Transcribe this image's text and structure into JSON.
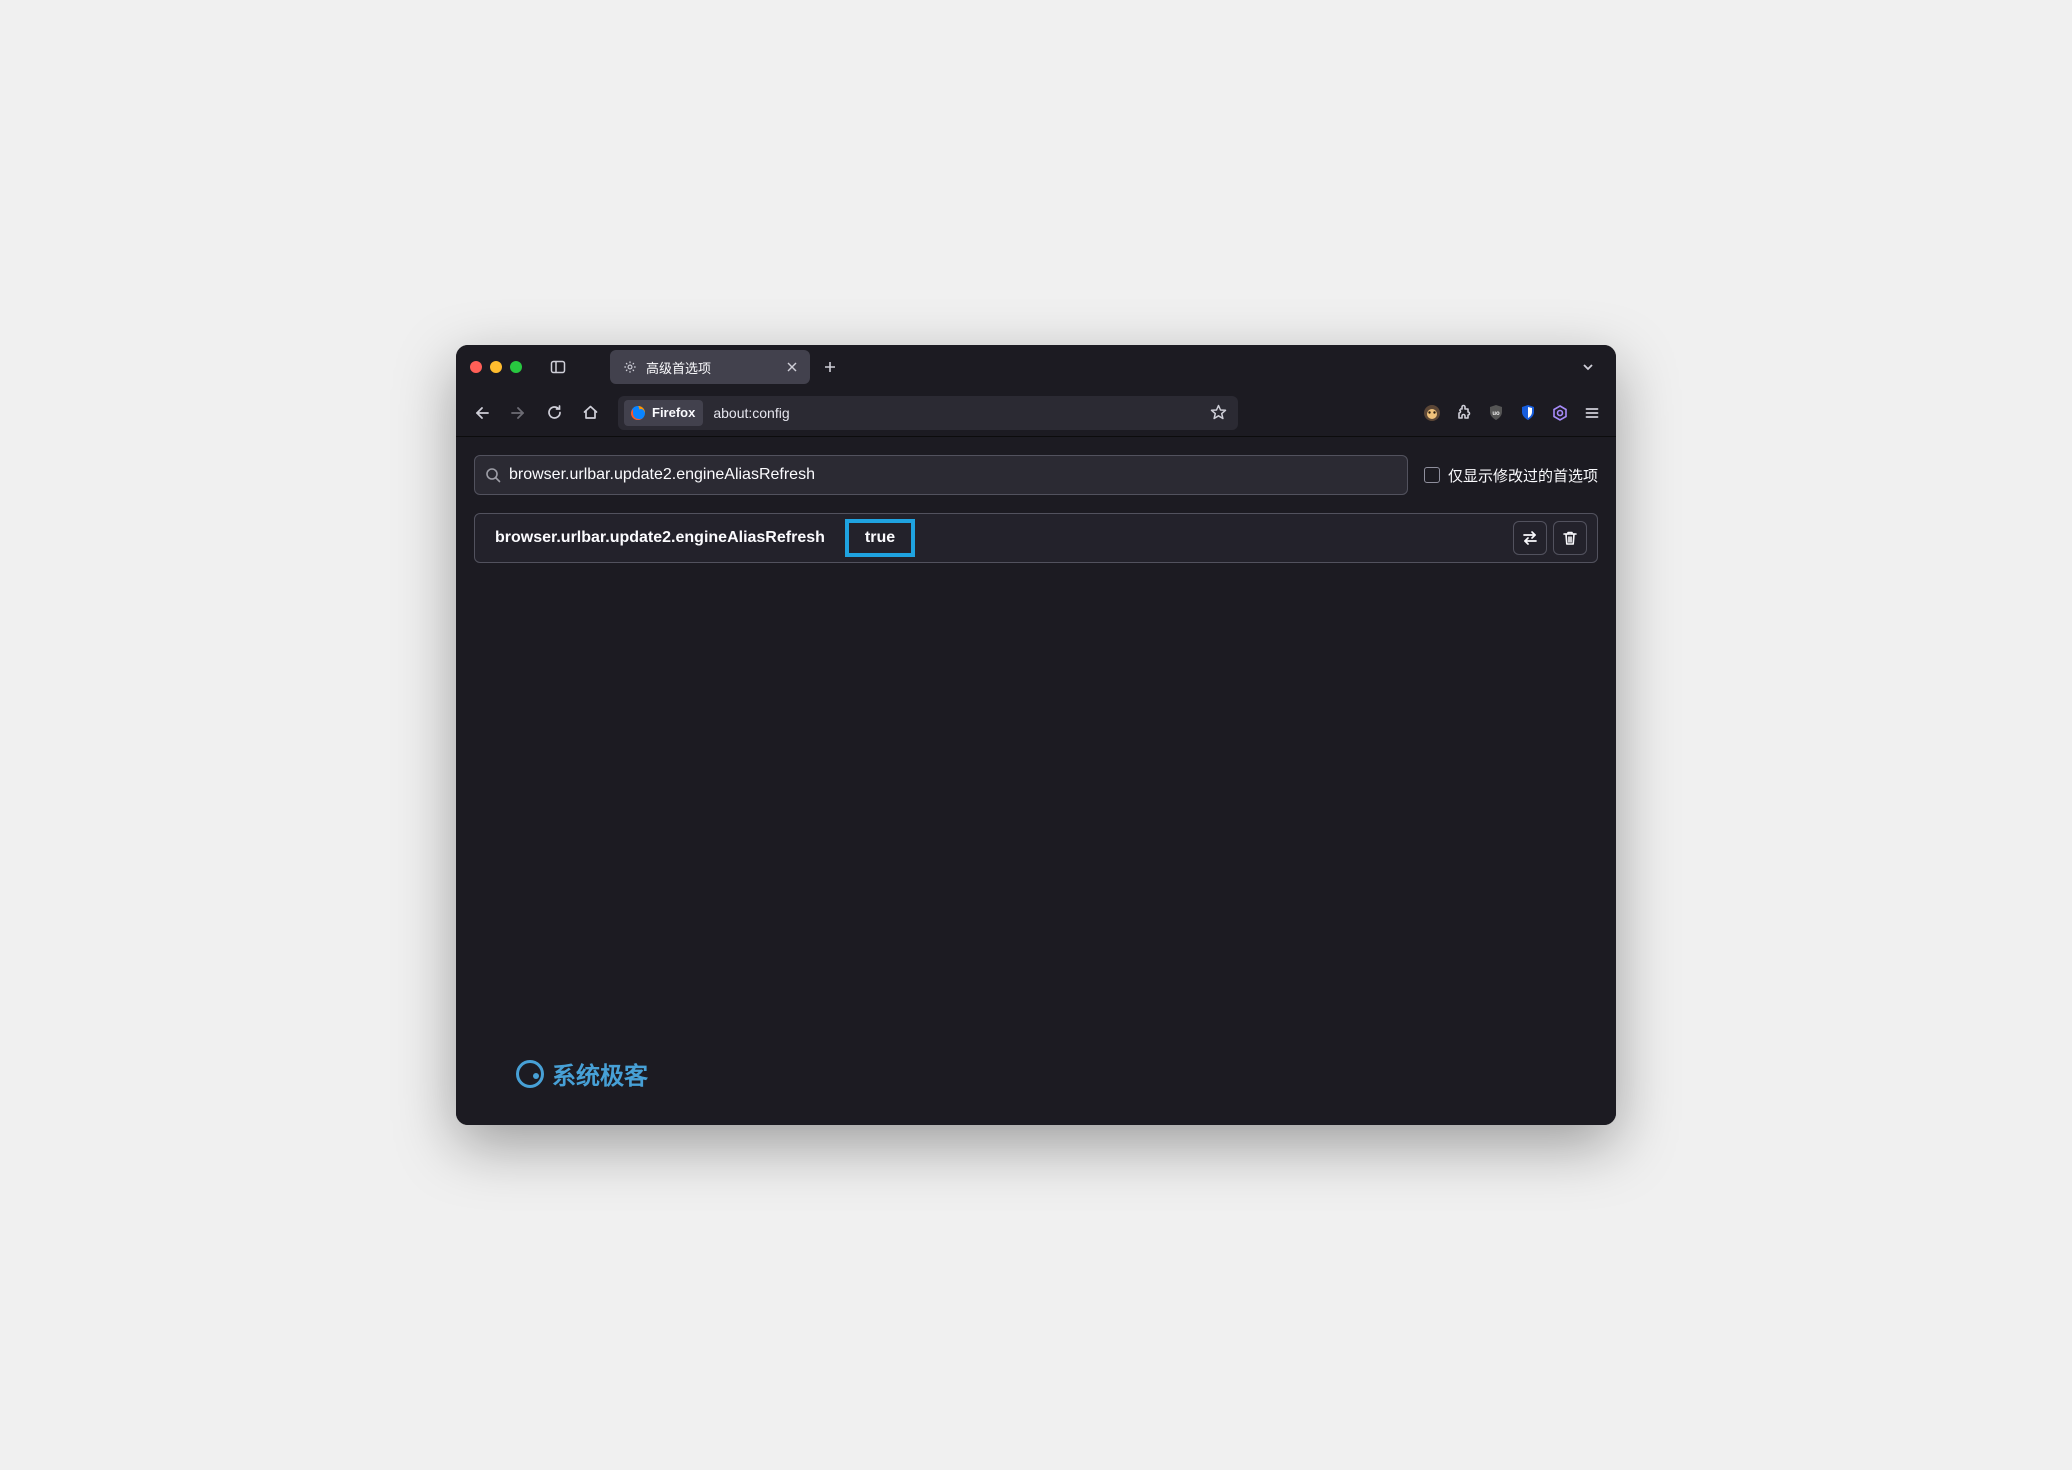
{
  "tab": {
    "title": "高级首选项"
  },
  "urlbar": {
    "identity_label": "Firefox",
    "url": "about:config"
  },
  "config": {
    "search_value": "browser.urlbar.update2.engineAliasRefresh",
    "show_modified_label": "仅显示修改过的首选项",
    "pref_name": "browser.urlbar.update2.engineAliasRefresh",
    "pref_value": "true"
  },
  "watermark": {
    "text": "系统极客"
  }
}
